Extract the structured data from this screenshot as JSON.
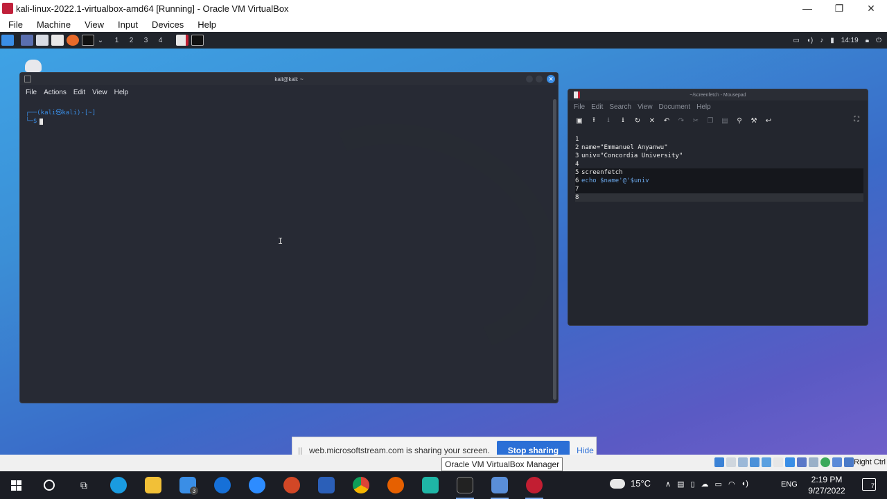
{
  "vbox": {
    "window_title": "kali-linux-2022.1-virtualbox-amd64 [Running] - Oracle VM VirtualBox",
    "window_buttons": {
      "minimize": "—",
      "maximize": "❐",
      "close": "✕"
    },
    "menu": [
      "File",
      "Machine",
      "View",
      "Input",
      "Devices",
      "Help"
    ],
    "status_host_key": "Right Ctrl",
    "tooltip": "Oracle VM VirtualBox Manager"
  },
  "kali_panel": {
    "workspaces": [
      "1",
      "2",
      "3",
      "4"
    ],
    "clock": "14:19"
  },
  "terminal": {
    "title": "kali@kali: ~",
    "menu": [
      "File",
      "Actions",
      "Edit",
      "View",
      "Help"
    ],
    "prompt_line1": "┌──(kali㉿kali)-[~]",
    "prompt_line2": "└─$",
    "close_glyph": "✕"
  },
  "mousepad": {
    "title": "~/screenfetch - Mousepad",
    "menu": [
      "File",
      "Edit",
      "Search",
      "View",
      "Document",
      "Help"
    ],
    "lines": [
      {
        "n": "1",
        "text": ""
      },
      {
        "n": "2",
        "text": "name=\"Emmanuel Anyanwu\""
      },
      {
        "n": "3",
        "text": "univ=\"Concordia University\""
      },
      {
        "n": "4",
        "text": ""
      },
      {
        "n": "5",
        "text": "screenfetch"
      },
      {
        "n": "6",
        "text": "echo $name'@'$univ"
      },
      {
        "n": "7",
        "text": ""
      },
      {
        "n": "8",
        "text": ""
      }
    ]
  },
  "share_bar": {
    "grip": "||",
    "message": "web.microsoftstream.com is sharing your screen.",
    "stop_label": "Stop sharing",
    "hide_label": "Hide"
  },
  "taskbar": {
    "mail_badge": "3",
    "temperature": "15°C",
    "language": "ENG",
    "time": "2:19 PM",
    "date": "9/27/2022",
    "notifications": "7"
  },
  "colors": {
    "accent": "#3a8ee6",
    "kali_red": "#c21e32",
    "stop_button": "#2b6fd6"
  }
}
